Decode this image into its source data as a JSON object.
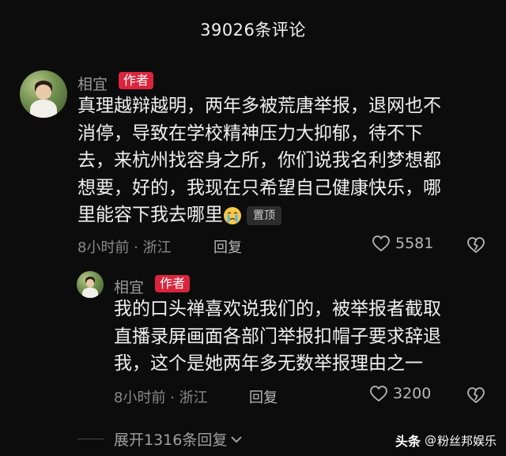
{
  "header": {
    "title": "39026条评论"
  },
  "comments": [
    {
      "username": "相宜",
      "badge": "作者",
      "text_lines": [
        "真理越辩越明，两年多被荒唐举报，退网也不",
        "消停，导致在学校精神压力大抑郁，待不下",
        "去，来杭州找容身之所，你们说我名利梦想都",
        "想要，好的，我现在只希望自己健康快乐，哪",
        "里能容下我去哪里"
      ],
      "emoji": "crying-face",
      "pinned_label": "置顶",
      "meta": "8小时前 · 浙江",
      "reply_label": "回复",
      "likes": "5581"
    },
    {
      "username": "相宜",
      "badge": "作者",
      "text_lines": [
        "我的口头禅喜欢说我们的，被举报者截取",
        "直播录屏画面各部门举报扣帽子要求辞退",
        "我，这个是她两年多无数举报理由之一"
      ],
      "meta": "8小时前 · 浙江",
      "reply_label": "回复",
      "likes": "3200"
    }
  ],
  "expand_replies": {
    "label": "展开1316条回复"
  },
  "watermark": {
    "platform": "头条",
    "at": "@",
    "account": "粉丝邦娱乐"
  },
  "colors": {
    "badge": "#d9253b",
    "background": "#0c0c0c"
  }
}
